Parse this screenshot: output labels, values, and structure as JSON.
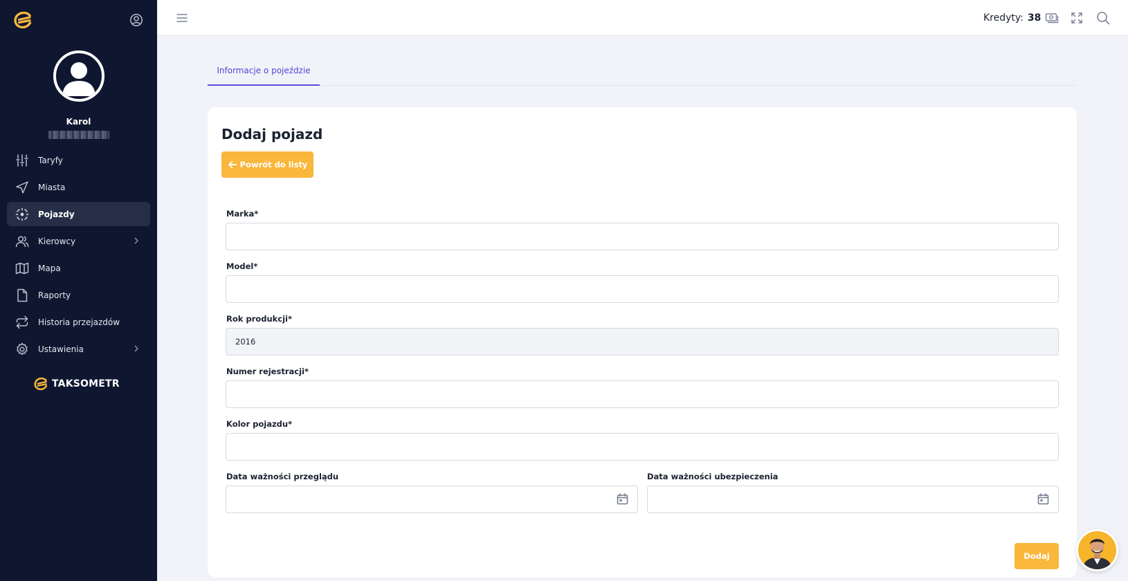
{
  "app": {
    "brand": "TAKSOMETR",
    "accent_color": "#f9b73b",
    "sidebar_color": "#0f1730"
  },
  "sidebar": {
    "user_name": "Karol",
    "items": [
      {
        "label": "Taryfy",
        "icon": "sliders-icon",
        "active": false,
        "has_children": false
      },
      {
        "label": "Miasta",
        "icon": "navigation-icon",
        "active": false,
        "has_children": false
      },
      {
        "label": "Pojazdy",
        "icon": "vehicle-icon",
        "active": true,
        "has_children": false
      },
      {
        "label": "Kierowcy",
        "icon": "users-icon",
        "active": false,
        "has_children": true
      },
      {
        "label": "Mapa",
        "icon": "map-icon",
        "active": false,
        "has_children": false
      },
      {
        "label": "Raporty",
        "icon": "file-icon",
        "active": false,
        "has_children": false
      },
      {
        "label": "Historia przejazdów",
        "icon": "repeat-icon",
        "active": false,
        "has_children": false
      },
      {
        "label": "Ustawienia",
        "icon": "gear-icon",
        "active": false,
        "has_children": true
      }
    ]
  },
  "topbar": {
    "credits_label": "Kredyty:",
    "credits_value": "38"
  },
  "tabs": [
    {
      "label": "Informacje o pojeździe",
      "active": true
    }
  ],
  "form": {
    "title": "Dodaj pojazd",
    "back_label": "Powrót do listy",
    "fields": {
      "marka": {
        "label": "Marka*",
        "value": ""
      },
      "model": {
        "label": "Model*",
        "value": ""
      },
      "rok": {
        "label": "Rok produkcji*",
        "value": "2016"
      },
      "numer": {
        "label": "Numer rejestracji*",
        "value": ""
      },
      "kolor": {
        "label": "Kolor pojazdu*",
        "value": ""
      },
      "przeglad": {
        "label": "Data ważności przeglądu",
        "value": ""
      },
      "ubezpieczenie": {
        "label": "Data ważności ubezpieczenia",
        "value": ""
      }
    },
    "submit_label": "Dodaj"
  }
}
